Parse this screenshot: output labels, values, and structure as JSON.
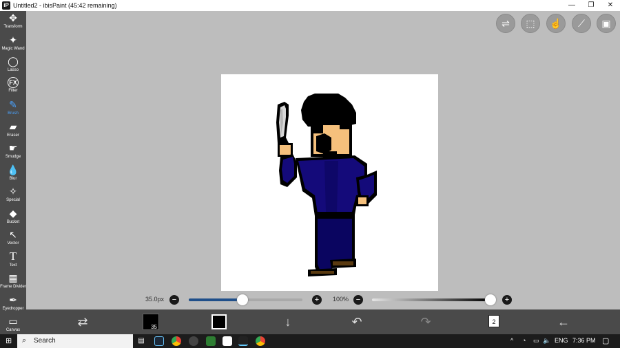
{
  "window": {
    "app_icon": "iP",
    "title": "Untitled2 - ibisPaint (45:42 remaining)",
    "controls": [
      "—",
      "❐",
      "✕"
    ]
  },
  "tools": [
    {
      "name": "transform",
      "label": "Transform",
      "icon": "✥"
    },
    {
      "name": "magic-wand",
      "label": "Magic Wand",
      "icon": "✦"
    },
    {
      "name": "lasso",
      "label": "Lasso",
      "icon": "◯"
    },
    {
      "name": "filter",
      "label": "Filter",
      "icon": "FX"
    },
    {
      "name": "brush",
      "label": "Brush",
      "icon": "✎",
      "active": true
    },
    {
      "name": "eraser",
      "label": "Eraser",
      "icon": "▰"
    },
    {
      "name": "smudge",
      "label": "Smudge",
      "icon": "☛"
    },
    {
      "name": "blur",
      "label": "Blur",
      "icon": "💧"
    },
    {
      "name": "special",
      "label": "Special",
      "icon": "✧"
    },
    {
      "name": "bucket",
      "label": "Bucket",
      "icon": "◆"
    },
    {
      "name": "vector",
      "label": "Vector",
      "icon": "↖"
    },
    {
      "name": "text",
      "label": "Text",
      "icon": "T"
    },
    {
      "name": "frame-divider",
      "label": "Frame Divider",
      "icon": "▦"
    },
    {
      "name": "eyedropper",
      "label": "Eyedropper",
      "icon": "✒"
    },
    {
      "name": "canvas",
      "label": "Canvas",
      "icon": "▭"
    }
  ],
  "top_right_buttons": [
    {
      "name": "toggle-panels",
      "icon": "⇌"
    },
    {
      "name": "selection",
      "icon": "⬚"
    },
    {
      "name": "hand",
      "icon": "☝"
    },
    {
      "name": "ruler",
      "icon": "⟋"
    },
    {
      "name": "reference",
      "icon": "▣"
    }
  ],
  "brush": {
    "size_label": "35.0px",
    "size_fraction": 0.47,
    "opacity_label": "100%",
    "opacity_fraction": 1.0,
    "minus": "−",
    "plus": "+"
  },
  "bottom_bar": {
    "brush_size_number": "35",
    "layer_count": "2",
    "icons": [
      "swap-colors",
      "brush-preview",
      "color",
      "download",
      "undo",
      "redo",
      "layers",
      "back"
    ]
  },
  "taskbar": {
    "search_placeholder": "Search",
    "language": "ENG",
    "time": "7:36 PM"
  },
  "colors": {
    "toolbar_bg": "#4a4a4a",
    "workspace_bg": "#bdbdbd",
    "accent": "#4aa3ff",
    "outline": "#000000",
    "skin": "#f5c07c",
    "shirt": "#140a7a",
    "shirt_dark": "#0a0560",
    "hair": "#000000",
    "knife_light": "#e0e0e0",
    "knife_mid": "#bdbdbd",
    "shoe": "#5a3a10"
  }
}
